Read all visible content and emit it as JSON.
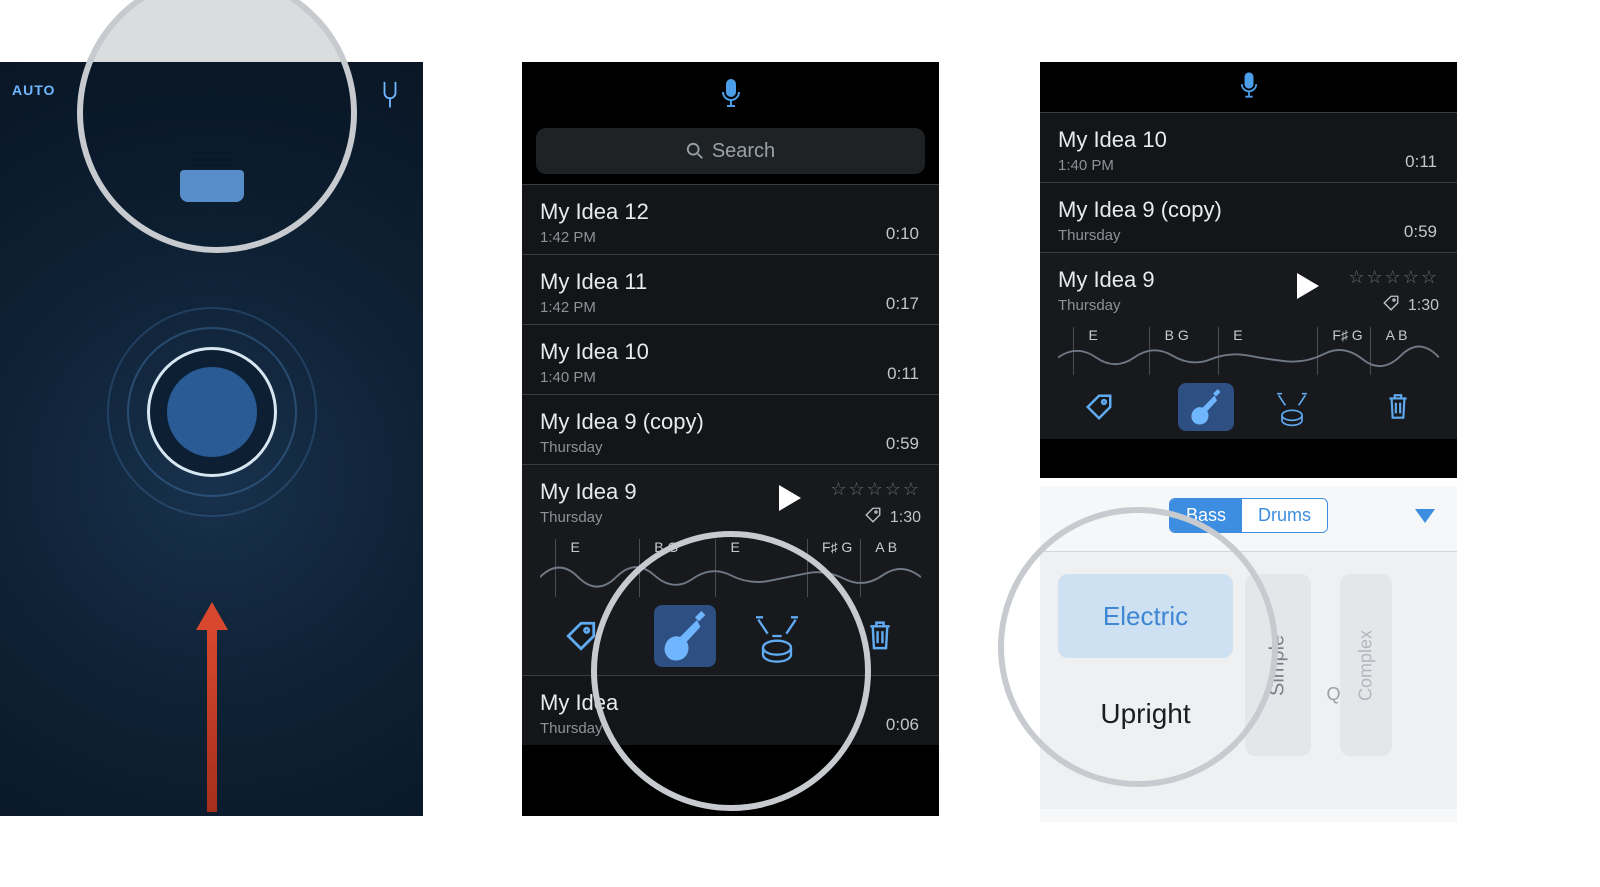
{
  "phone1": {
    "auto_label": "AUTO"
  },
  "phone2": {
    "search_placeholder": "Search",
    "items": [
      {
        "title": "My Idea 12",
        "sub": "1:42 PM",
        "dur": "0:10"
      },
      {
        "title": "My Idea 11",
        "sub": "1:42 PM",
        "dur": "0:17"
      },
      {
        "title": "My Idea 10",
        "sub": "1:40 PM",
        "dur": "0:11"
      },
      {
        "title": "My Idea 9 (copy)",
        "sub": "Thursday",
        "dur": "0:59"
      }
    ],
    "expanded": {
      "title": "My Idea 9",
      "sub": "Thursday",
      "stars": "☆☆☆☆☆",
      "dur": "1:30",
      "chords": [
        "E",
        "B G",
        "E",
        "F♯ G",
        "A B"
      ]
    },
    "tail": {
      "title": "My Idea",
      "sub": "Thursday",
      "dur": "0:06"
    }
  },
  "phone3": {
    "items": [
      {
        "title": "My Idea 10",
        "sub": "1:40 PM",
        "dur": "0:11"
      },
      {
        "title": "My Idea 9 (copy)",
        "sub": "Thursday",
        "dur": "0:59"
      }
    ],
    "expanded": {
      "title": "My Idea 9",
      "sub": "Thursday",
      "stars": "☆☆☆☆☆",
      "dur": "1:30",
      "chords": [
        "E",
        "B G",
        "E",
        "F♯ G",
        "A B"
      ]
    }
  },
  "picker": {
    "segments": [
      "Bass",
      "Drums"
    ],
    "selected_segment": 0,
    "pads": {
      "electric": "Electric",
      "upright": "Upright",
      "simple": "Simple",
      "quiet": "Quiet",
      "complex": "Complex"
    }
  }
}
